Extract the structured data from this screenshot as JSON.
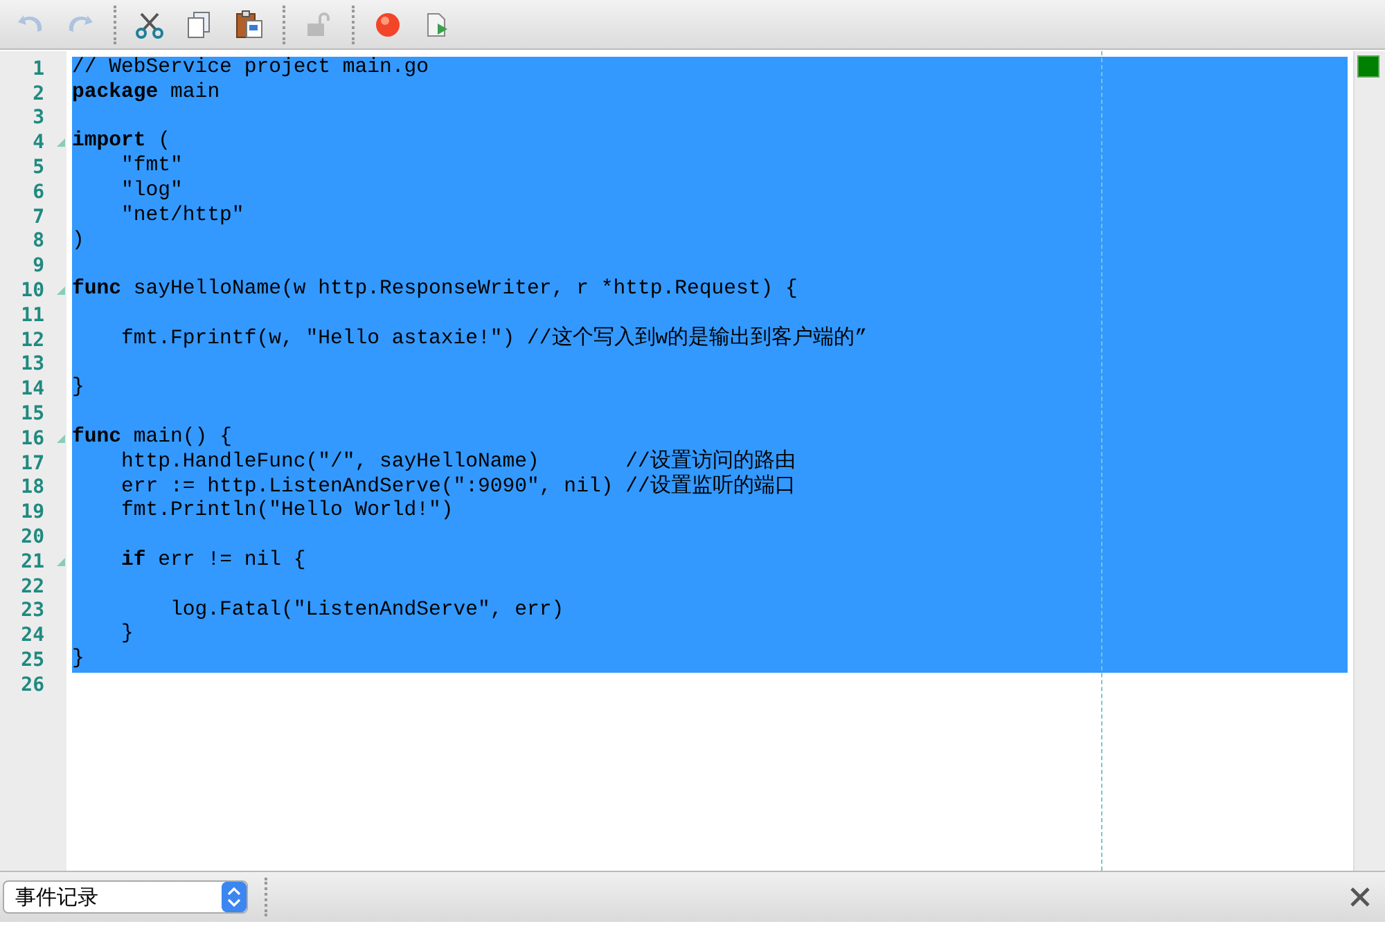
{
  "toolbar": {
    "buttons": [
      {
        "kind": "undo",
        "disabled": true
      },
      {
        "kind": "redo",
        "disabled": true
      },
      {
        "kind": "sep"
      },
      {
        "kind": "cut",
        "disabled": false
      },
      {
        "kind": "copy",
        "disabled": false
      },
      {
        "kind": "paste",
        "disabled": false
      },
      {
        "kind": "sep"
      },
      {
        "kind": "lock",
        "disabled": true
      },
      {
        "kind": "sep"
      },
      {
        "kind": "record",
        "disabled": false
      },
      {
        "kind": "run",
        "disabled": false
      }
    ]
  },
  "editor": {
    "lines": [
      {
        "number": "1",
        "text": "// WebService project main.go",
        "foldable": false,
        "selected": true
      },
      {
        "number": "2",
        "text": "**package** main",
        "foldable": false,
        "selected": true
      },
      {
        "number": "3",
        "foldable": false,
        "selected": true
      },
      {
        "number": "4",
        "text": "**import** (",
        "foldable": true,
        "selected": true
      },
      {
        "number": "5",
        "text": "    \"fmt\"",
        "foldable": false,
        "selected": true
      },
      {
        "number": "6",
        "text": "    \"log\"",
        "foldable": false,
        "selected": true
      },
      {
        "number": "7",
        "text": "    \"net/http\"",
        "foldable": false,
        "selected": true
      },
      {
        "number": "8",
        "text": ")",
        "foldable": false,
        "selected": true
      },
      {
        "number": "9",
        "foldable": false,
        "selected": true
      },
      {
        "number": "10",
        "text": "**func** sayHelloName(w http.ResponseWriter, r *http.Request) {",
        "foldable": true,
        "selected": true
      },
      {
        "number": "11",
        "foldable": false,
        "selected": true
      },
      {
        "number": "12",
        "text": "    fmt.Fprintf(w, \"Hello astaxie!\") //这个写入到w的是输出到客户端的”",
        "foldable": false,
        "selected": true
      },
      {
        "number": "13",
        "foldable": false,
        "selected": true
      },
      {
        "number": "14",
        "text": "}",
        "foldable": false,
        "selected": true
      },
      {
        "number": "15",
        "foldable": false,
        "selected": true
      },
      {
        "number": "16",
        "text": "**func** main() {",
        "foldable": true,
        "selected": true
      },
      {
        "number": "17",
        "text": "    http.HandleFunc(\"/\", sayHelloName)       //设置访问的路由",
        "foldable": false,
        "selected": true
      },
      {
        "number": "18",
        "text": "    err := http.ListenAndServe(\":9090\", nil) //设置监听的端口",
        "foldable": false,
        "selected": true
      },
      {
        "number": "19",
        "text": "    fmt.Println(\"Hello World!\")",
        "foldable": false,
        "selected": true
      },
      {
        "number": "20",
        "foldable": false,
        "selected": true
      },
      {
        "number": "21",
        "text": "    **if** err != nil {",
        "foldable": true,
        "selected": true
      },
      {
        "number": "22",
        "foldable": false,
        "selected": true
      },
      {
        "number": "23",
        "text": "        log.Fatal(\"ListenAndServe\", err)",
        "foldable": false,
        "selected": true
      },
      {
        "number": "24",
        "text": "    }",
        "foldable": false,
        "selected": true
      },
      {
        "number": "25",
        "text": "}",
        "foldable": false,
        "selected": true
      },
      {
        "number": "26",
        "foldable": false,
        "selected": false
      }
    ]
  },
  "bottom_bar": {
    "dropdown": {
      "value": "事件记录"
    }
  }
}
